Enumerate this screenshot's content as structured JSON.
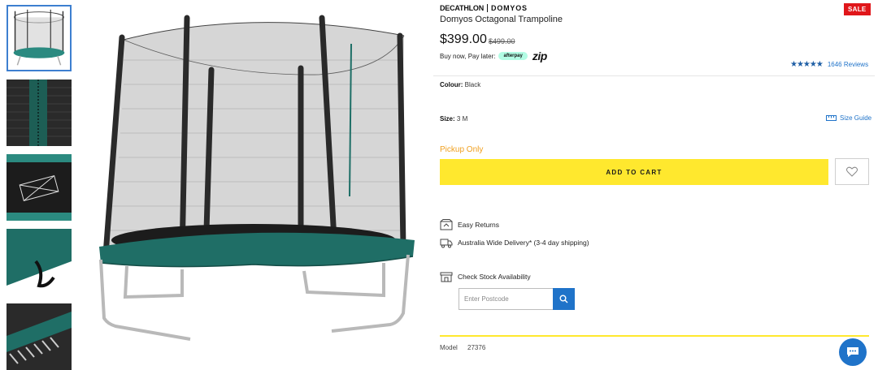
{
  "brand": {
    "name": "DECATHLON",
    "sub": "DOMYOS"
  },
  "badge": "SALE",
  "product": {
    "title": "Domyos Octagonal Trampoline",
    "price": "$399.00",
    "old_price": "$499.00"
  },
  "bnpl": {
    "label": "Buy now, Pay later:",
    "afterpay": "afterpay",
    "zip": "zip"
  },
  "rating": {
    "stars": "★★★★★",
    "reviews": "1646 Reviews"
  },
  "colour": {
    "label": "Colour:",
    "value": "Black"
  },
  "size": {
    "label": "Size:",
    "value": "3 M",
    "guide": "Size Guide"
  },
  "pickup": "Pickup Only",
  "add_to_cart": "ADD TO CART",
  "features": {
    "returns": "Easy Returns",
    "delivery": "Australia Wide Delivery* (3-4 day shipping)",
    "stock": "Check Stock Availability"
  },
  "postcode": {
    "placeholder": "Enter Postcode"
  },
  "model": {
    "label": "Model",
    "value": "27376"
  },
  "colors": {
    "accent": "#1f73c9",
    "cta": "#ffe82e",
    "sale": "#e0161a",
    "pickup": "#f0a020"
  },
  "icons": [
    "heart-icon",
    "search-icon",
    "chat-icon",
    "ruler-icon",
    "box-icon",
    "truck-icon",
    "store-icon"
  ]
}
